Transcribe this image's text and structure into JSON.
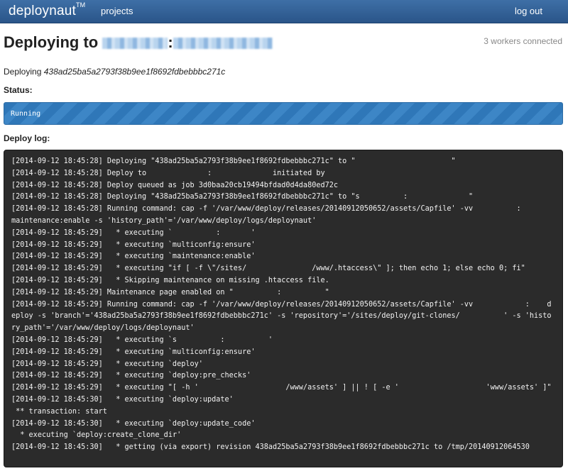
{
  "navbar": {
    "brand": "deploynaut",
    "brand_mark": "TM",
    "projects_label": "projects",
    "logout_label": "log out"
  },
  "header": {
    "workers": "3 workers connected",
    "title_prefix": "Deploying to",
    "title_separator": ":",
    "commit_prefix": "Deploying",
    "commit_sha": "438ad25ba5a2793f38b9ee1f8692fdbebbbc271c"
  },
  "status": {
    "label": "Status:",
    "value": "Running"
  },
  "log": {
    "label": "Deploy log:",
    "lines": [
      "[2014-09-12 18:45:28] Deploying \"438ad25ba5a2793f38b9ee1f8692fdbebbbc271c\" to \"                      \"",
      "[2014-09-12 18:45:28] Deploy to              :              initiated by                       ",
      "[2014-09-12 18:45:28] Deploy queued as job 3d0baa20cb19494bfdad0d4da80ed72c",
      "[2014-09-12 18:45:28] Deploying \"438ad25ba5a2793f38b9ee1f8692fdbebbbc271c\" to \"s          :              \"",
      "[2014-09-12 18:45:28] Running command: cap -f '/var/www/deploy/releases/20140912050652/assets/Capfile' -vv          :          maintenance:enable -s 'history_path'='/var/www/deploy/logs/deploynaut'",
      "[2014-09-12 18:45:29]   * executing `          :       '",
      "[2014-09-12 18:45:29]   * executing `multiconfig:ensure'",
      "[2014-09-12 18:45:29]   * executing `maintenance:enable'",
      "[2014-09-12 18:45:29]   * executing \"if [ -f \\\"/sites/               /www/.htaccess\\\" ]; then echo 1; else echo 0; fi\"",
      "[2014-09-12 18:45:29]   * Skipping maintenance on missing .htaccess file.",
      "[2014-09-12 18:45:29] Maintenance page enabled on \"          :          \"",
      "[2014-09-12 18:45:29] Running command: cap -f '/var/www/deploy/releases/20140912050652/assets/Capfile' -vv            :    deploy -s 'branch'='438ad25ba5a2793f38b9ee1f8692fdbebbbc271c' -s 'repository'='/sites/deploy/git-clones/          ' -s 'history_path'='/var/www/deploy/logs/deploynaut'",
      "[2014-09-12 18:45:29]   * executing `s          :          '",
      "[2014-09-12 18:45:29]   * executing `multiconfig:ensure'",
      "[2014-09-12 18:45:29]   * executing `deploy'",
      "[2014-09-12 18:45:29]   * executing `deploy:pre_checks'",
      "[2014-09-12 18:45:29]   * executing \"[ -h '                    /www/assets' ] || ! [ -e '                    'www/assets' ]\"",
      "[2014-09-12 18:45:30]   * executing `deploy:update'",
      " ** transaction: start",
      "[2014-09-12 18:45:30]   * executing `deploy:update_code'",
      "  * executing `deploy:create_clone_dir'",
      "[2014-09-12 18:45:30]   * getting (via export) revision 438ad25ba5a2793f38b9ee1f8692fdbebbbc271c to /tmp/20140912064530"
    ]
  }
}
